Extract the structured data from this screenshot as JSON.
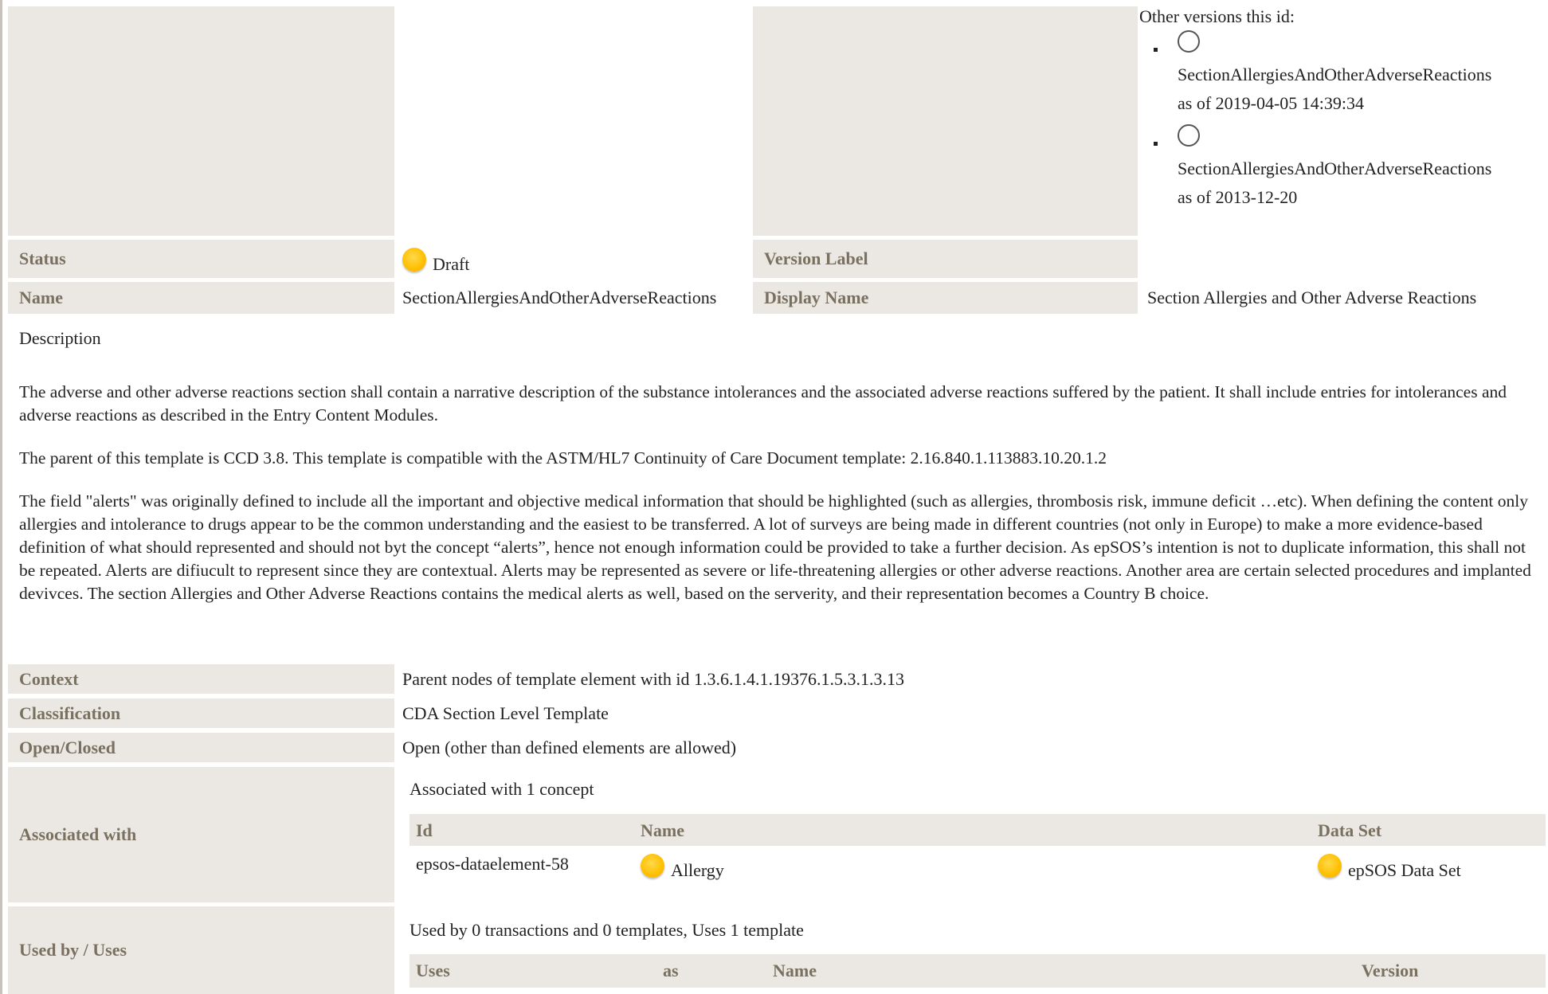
{
  "other_versions": {
    "title": "Other versions this id:",
    "items": [
      {
        "name": "SectionAllergiesAndOtherAdverseReactions",
        "date": "as of 2019-04-05 14:39:34"
      },
      {
        "name": "SectionAllergiesAndOtherAdverseReactions",
        "date": "as of 2013-12-20"
      }
    ]
  },
  "status": {
    "label": "Status",
    "value": "Draft",
    "icon": "status-draft-icon",
    "color": "#ffbf00"
  },
  "version_label": {
    "label": "Version Label",
    "value": ""
  },
  "name": {
    "label": "Name",
    "value": "SectionAllergiesAndOtherAdverseReactions"
  },
  "display_name": {
    "label": "Display Name",
    "value": "Section Allergies and Other Adverse Reactions"
  },
  "description": {
    "label": "Description",
    "paragraphs": [
      "The adverse and other adverse reactions section shall contain a narrative description of the substance intolerances and the associated adverse reactions suffered by the patient. It shall include entries for intolerances and adverse reactions as described in the Entry Content Modules.",
      "The parent of this template is CCD 3.8. This template is compatible with the ASTM/HL7 Continuity of Care Document template: 2.16.840.1.113883.10.20.1.2",
      "The field \"alerts\" was originally defined to include all the important and objective medical information that should be highlighted (such as allergies, thrombosis risk, immune deficit …etc). When defining the content only allergies and intolerance to drugs appear to be the common understanding and the easiest to be transferred. A lot of surveys are being made in different countries (not only in Europe) to make a more evidence-based definition of what should represented and should not byt the concept “alerts”, hence not enough information could be provided to take a further decision. As epSOS’s intention is not to duplicate information, this shall not be repeated. Alerts are difiucult to represent since they are contextual. Alerts may be represented as severe or life-threatening allergies or other adverse reactions. Another area are certain selected procedures and implanted devivces. The section Allergies and Other Adverse Reactions contains the medical alerts as well, based on the serverity, and their representation becomes a Country B choice."
    ]
  },
  "context": {
    "label": "Context",
    "value": "Parent nodes of template element with id 1.3.6.1.4.1.19376.1.5.3.1.3.13"
  },
  "classification": {
    "label": "Classification",
    "value": "CDA Section Level Template"
  },
  "open_closed": {
    "label": "Open/Closed",
    "value": "Open (other than defined elements are allowed)"
  },
  "associated": {
    "label": "Associated with",
    "summary": "Associated with 1 concept",
    "headers": {
      "id": "Id",
      "name": "Name",
      "dataset": "Data Set"
    },
    "rows": [
      {
        "id": "epsos-dataelement-58",
        "name": "Allergy",
        "dataset": "epSOS Data Set"
      }
    ]
  },
  "used_by": {
    "label": "Used by / Uses",
    "summary": "Used by 0 transactions and 0 templates, Uses 1 template",
    "headers": {
      "uses": "Uses",
      "as": "as",
      "name": "Name",
      "version": "Version"
    }
  }
}
